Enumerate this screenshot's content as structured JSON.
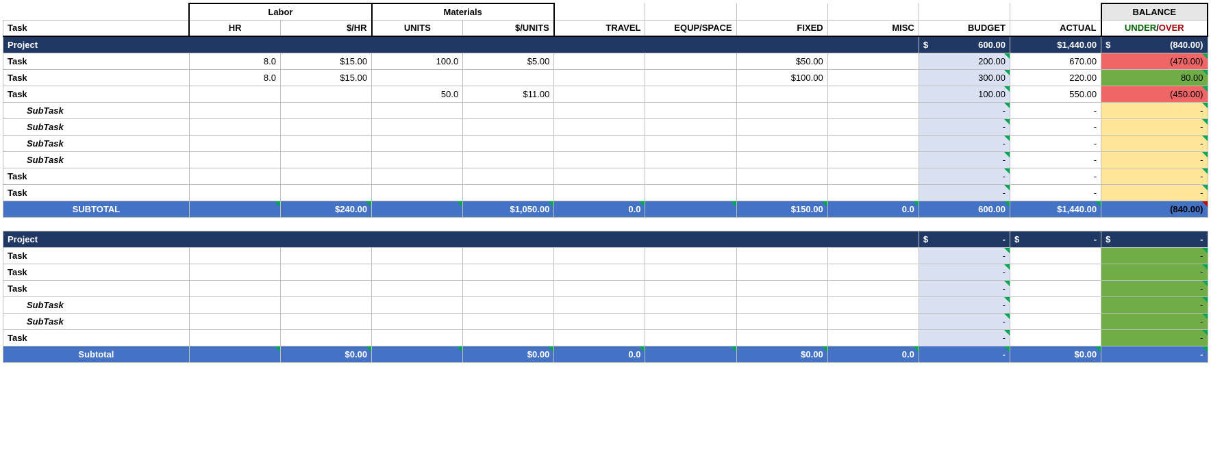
{
  "headers": {
    "task": "Task",
    "labor": "Labor",
    "hr": "HR",
    "perhr": "$/HR",
    "materials": "Materials",
    "units": "UNITS",
    "perunits": "$/UNITS",
    "travel": "TRAVEL",
    "equp": "EQUP/SPACE",
    "fixed": "FIXED",
    "misc": "MISC",
    "budget": "BUDGET",
    "actual": "ACTUAL",
    "balance": "BALANCE",
    "under": "UNDER",
    "slash": "/",
    "over": "OVER"
  },
  "p1": {
    "title": "Project",
    "budget_sym": "$",
    "budget": "600.00",
    "actual": "$1,440.00",
    "balance_sym": "$",
    "balance": "(840.00)",
    "rows": [
      {
        "name": "Task",
        "hr": "8.0",
        "perhr": "$15.00",
        "units": "100.0",
        "perunits": "$5.00",
        "travel": "",
        "equp": "",
        "fixed": "$50.00",
        "misc": "",
        "budget": "200.00",
        "actual": "670.00",
        "balance": "(470.00)",
        "bal_bg": "red"
      },
      {
        "name": "Task",
        "hr": "8.0",
        "perhr": "$15.00",
        "units": "",
        "perunits": "",
        "travel": "",
        "equp": "",
        "fixed": "$100.00",
        "misc": "",
        "budget": "300.00",
        "actual": "220.00",
        "balance": "80.00",
        "bal_bg": "green"
      },
      {
        "name": "Task",
        "hr": "",
        "perhr": "",
        "units": "50.0",
        "perunits": "$11.00",
        "travel": "",
        "equp": "",
        "fixed": "",
        "misc": "",
        "budget": "100.00",
        "actual": "550.00",
        "balance": "(450.00)",
        "bal_bg": "red"
      },
      {
        "name": "SubTask",
        "indent": true,
        "italic": true,
        "budget": "-",
        "actual": "-",
        "balance": "-",
        "bal_bg": "yellow"
      },
      {
        "name": "SubTask",
        "indent": true,
        "italic": true,
        "budget": "-",
        "actual": "-",
        "balance": "-",
        "bal_bg": "yellow"
      },
      {
        "name": "SubTask",
        "indent": true,
        "italic": true,
        "budget": "-",
        "actual": "-",
        "balance": "-",
        "bal_bg": "yellow"
      },
      {
        "name": "SubTask",
        "indent": true,
        "italic": true,
        "budget": "-",
        "actual": "-",
        "balance": "-",
        "bal_bg": "yellow"
      },
      {
        "name": "Task",
        "budget": "-",
        "actual": "-",
        "balance": "-",
        "bal_bg": "yellow"
      },
      {
        "name": "Task",
        "budget": "-",
        "actual": "-",
        "balance": "-",
        "bal_bg": "yellow"
      }
    ],
    "subtotal": {
      "label": "SUBTOTAL",
      "perhr": "$240.00",
      "perunits": "$1,050.00",
      "travel": "0.0",
      "fixed": "$150.00",
      "misc": "0.0",
      "budget": "600.00",
      "actual": "$1,440.00",
      "balance": "(840.00)"
    }
  },
  "p2": {
    "title": "Project",
    "budget_sym": "$",
    "budget": "-",
    "actual_sym": "$",
    "actual": "-",
    "balance_sym": "$",
    "balance": "-",
    "rows": [
      {
        "name": "Task",
        "budget": "-",
        "balance": "-",
        "bal_bg": "green"
      },
      {
        "name": "Task",
        "budget": "-",
        "balance": "-",
        "bal_bg": "green"
      },
      {
        "name": "Task",
        "budget": "-",
        "balance": "-",
        "bal_bg": "green"
      },
      {
        "name": "SubTask",
        "indent": true,
        "italic": true,
        "budget": "-",
        "balance": "-",
        "bal_bg": "green"
      },
      {
        "name": "SubTask",
        "indent": true,
        "italic": true,
        "budget": "-",
        "balance": "-",
        "bal_bg": "green"
      },
      {
        "name": "Task",
        "budget": "-",
        "balance": "-",
        "bal_bg": "green"
      }
    ],
    "subtotal": {
      "label": "Subtotal",
      "perhr": "$0.00",
      "perunits": "$0.00",
      "travel": "0.0",
      "fixed": "$0.00",
      "misc": "0.0",
      "budget": "-",
      "actual": "$0.00",
      "balance": "-"
    }
  }
}
